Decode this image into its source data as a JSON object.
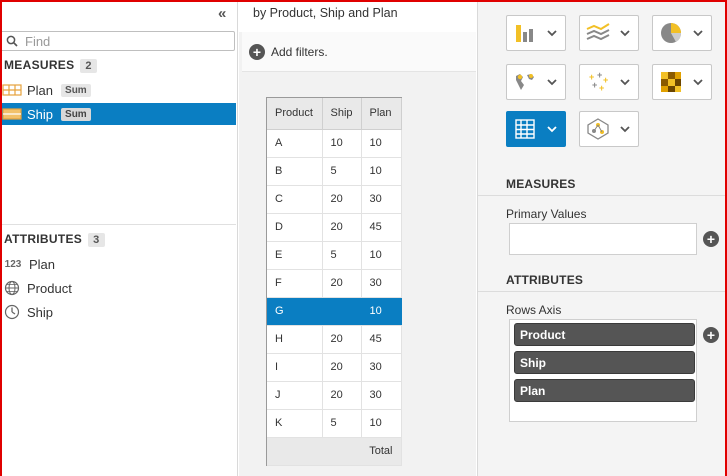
{
  "colors": {
    "accent": "#0a7ec2",
    "frame": "#e00000",
    "pill": "#555555"
  },
  "left": {
    "collapse_glyph": "«",
    "search": {
      "placeholder": "Find"
    },
    "measures": {
      "title": "MEASURES",
      "count": "2",
      "items": [
        {
          "label": "Plan",
          "agg": "Sum",
          "icon": "measure-icon",
          "selected": false
        },
        {
          "label": "Ship",
          "agg": "Sum",
          "icon": "measure-icon",
          "selected": true
        }
      ]
    },
    "attributes": {
      "title": "ATTRIBUTES",
      "count": "3",
      "items": [
        {
          "label": "Plan",
          "icon": "numeric-icon",
          "icon_text": "123"
        },
        {
          "label": "Product",
          "icon": "globe-icon"
        },
        {
          "label": "Ship",
          "icon": "clock-icon"
        }
      ]
    }
  },
  "middle": {
    "subtitle": "by Product, Ship and Plan",
    "add_filters": "Add filters.",
    "table": {
      "headers": [
        "Product",
        "Ship",
        "Plan"
      ],
      "rows": [
        [
          "A",
          "10",
          "10"
        ],
        [
          "B",
          "5",
          "10"
        ],
        [
          "C",
          "20",
          "30"
        ],
        [
          "D",
          "20",
          "45"
        ],
        [
          "E",
          "5",
          "10"
        ],
        [
          "F",
          "20",
          "30"
        ],
        [
          "G",
          "",
          "10"
        ],
        [
          "H",
          "20",
          "45"
        ],
        [
          "I",
          "20",
          "30"
        ],
        [
          "J",
          "20",
          "30"
        ],
        [
          "K",
          "5",
          "10"
        ]
      ],
      "selected_row": "G",
      "total_label": "Total"
    }
  },
  "right": {
    "viz_buttons": [
      {
        "icon": "bar-chart-icon",
        "active": false
      },
      {
        "icon": "line-chart-icon",
        "active": false
      },
      {
        "icon": "pie-chart-icon",
        "active": false
      },
      {
        "icon": "geo-map-icon",
        "active": false
      },
      {
        "icon": "scatter-plot-icon",
        "active": false
      },
      {
        "icon": "heatmap-icon",
        "active": false
      },
      {
        "icon": "table-icon",
        "active": true
      },
      {
        "icon": "network-chart-icon",
        "active": false
      }
    ],
    "measures_title": "MEASURES",
    "primary_values_label": "Primary Values",
    "attributes_title": "ATTRIBUTES",
    "rows_axis_label": "Rows Axis",
    "rows_axis_pills": [
      "Product",
      "Ship",
      "Plan"
    ]
  }
}
